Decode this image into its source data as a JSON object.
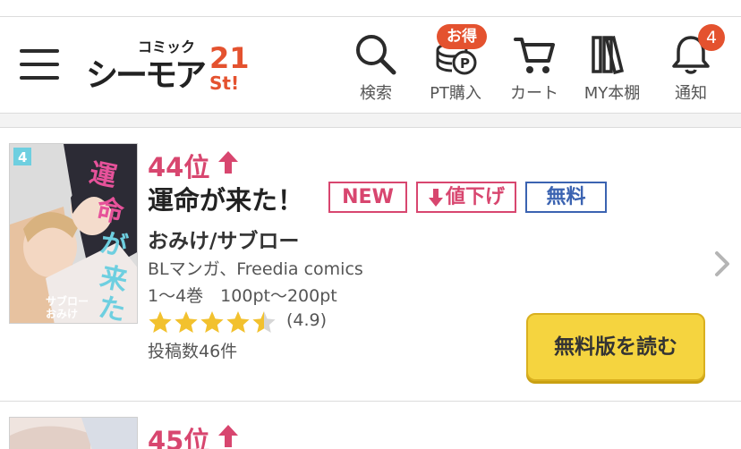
{
  "header": {
    "logo_text_small": "コミック",
    "logo_text_main": "シーモア",
    "logo_text_num": "21",
    "logo_text_st": "St!",
    "nav": {
      "search": "検索",
      "pt": "PT購入",
      "pt_badge": "お得",
      "cart": "カート",
      "shelf": "MY本棚",
      "notify": "通知",
      "notify_count": "4"
    }
  },
  "items": [
    {
      "rank": "44",
      "rank_suffix": "位",
      "title": "運命が来た！",
      "tags": {
        "new": "NEW",
        "price_down": "値下げ",
        "free": "無料"
      },
      "author": "おみけ/サブロー",
      "genre": "BLマンガ、Freedia comics",
      "volumes": "1〜4巻　100pt〜200pt",
      "stars": 4.5,
      "rating": "(4.9)",
      "reviews": "投稿数46件",
      "button": "無料版を読む",
      "cover_volume": "4"
    },
    {
      "rank": "45",
      "rank_suffix": "位"
    }
  ],
  "colors": {
    "rank": "#d8466f",
    "tag_red": "#d8466f",
    "tag_blue": "#3b63b1",
    "button": "#f5d43f",
    "star": "#f2c12e",
    "badge": "#e4522f"
  }
}
